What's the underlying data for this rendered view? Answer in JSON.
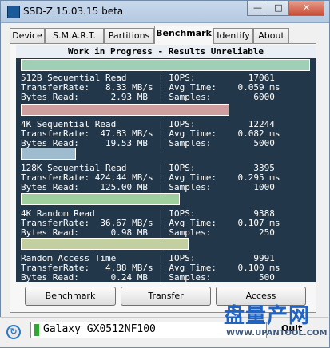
{
  "window": {
    "title": "SSD-Z 15.03.15 beta",
    "controls": {
      "minimize": "—",
      "maximize": "□",
      "close": "✕"
    }
  },
  "tabs": [
    "Device",
    "S.M.A.R.T.",
    "Partitions",
    "Benchmark",
    "Identify",
    "About"
  ],
  "active_tab": "Benchmark",
  "banner": "Work in Progress - Results Unreliable",
  "results": [
    {
      "name_line": "512B Sequential Read      | IOPS:          17061",
      "rate_line": "TransferRate:   8.33 MB/s | Avg Time:    0.059 ms",
      "bytes_line": "Bytes Read:      2.93 MB  | Samples:        6000",
      "bar_fraction": 1.0,
      "bar_color": "#9fcfb4"
    },
    {
      "name_line": "4K Sequential Read        | IOPS:          12244",
      "rate_line": "TransferRate:  47.83 MB/s | Avg Time:    0.082 ms",
      "bytes_line": "Bytes Read:     19.53 MB  | Samples:        5000",
      "bar_fraction": 0.72,
      "bar_color": "#cf9f9f"
    },
    {
      "name_line": "128K Sequential Read      | IOPS:           3395",
      "rate_line": "TransferRate: 424.44 MB/s | Avg Time:    0.295 ms",
      "bytes_line": "Bytes Read:    125.00 MB  | Samples:        1000",
      "bar_fraction": 0.19,
      "bar_color": "#9fbccf"
    },
    {
      "name_line": "4K Random Read            | IOPS:           9388",
      "rate_line": "TransferRate:  36.67 MB/s | Avg Time:    0.107 ms",
      "bytes_line": "Bytes Read:      0.98 MB  | Samples:         250",
      "bar_fraction": 0.55,
      "bar_color": "#9fcf9f"
    },
    {
      "name_line": "Random Access Time        | IOPS:           9991",
      "rate_line": "TransferRate:   4.88 MB/s | Avg Time:    0.100 ms",
      "bytes_line": "Bytes Read:      0.24 MB  | Samples:         500",
      "bar_fraction": 0.58,
      "bar_color": "#c3cf9f"
    }
  ],
  "buttons": {
    "benchmark": "Benchmark",
    "transfer": "Transfer",
    "access": "Access"
  },
  "status": {
    "drive": "Galaxy GX0512NF100",
    "quit": "Quit"
  },
  "watermark": {
    "cn": "盘量产网",
    "url": "WWW.UPANTOOL.COM"
  }
}
